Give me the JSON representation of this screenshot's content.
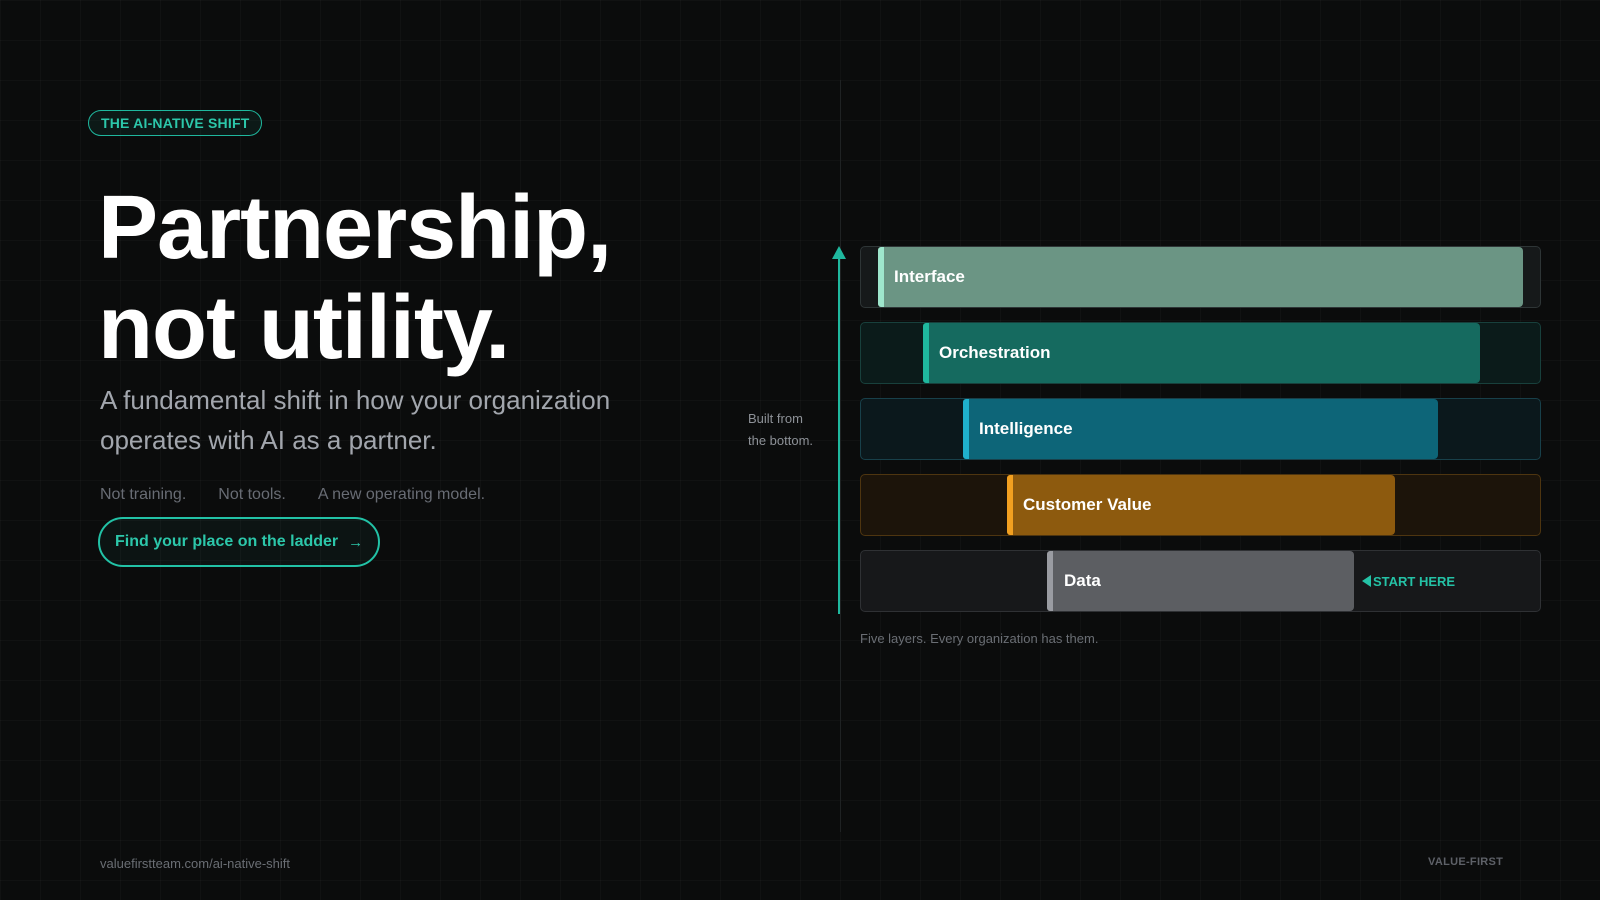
{
  "header": {
    "pill_label": "THE AI-NATIVE SHIFT"
  },
  "hero": {
    "headline_line1": "Partnership,",
    "headline_line2": "not utility.",
    "subtitle": "A fundamental shift in how your organization operates with AI as a partner.",
    "taglines": [
      "Not training.",
      "Not tools.",
      "A new operating model."
    ],
    "cta_label": "Find your place on the ladder",
    "cta_icon": "arrow-right-icon",
    "cta_arrow": "→"
  },
  "ladder": {
    "axis_label_line1": "Built from",
    "axis_label_line2": "the bottom.",
    "layers": [
      {
        "label": "Interface",
        "color": "#6b9584",
        "accent": "#9ee6cc"
      },
      {
        "label": "Orchestration",
        "color": "#156a5f",
        "accent": "#1fb89e"
      },
      {
        "label": "Intelligence",
        "color": "#0d6578",
        "accent": "#1fb0cc"
      },
      {
        "label": "Customer Value",
        "color": "#8d5a0e",
        "accent": "#f2a020"
      },
      {
        "label": "Data",
        "color": "#5c5e62",
        "accent": "#9a9ca2"
      }
    ],
    "start_marker": "START HERE",
    "start_icon": "triangle-left-icon",
    "caption": "Five layers. Every organization has them."
  },
  "footer": {
    "url": "valuefirstteam.com/ai-native-shift",
    "brand": "VALUE-FIRST"
  },
  "colors": {
    "accent": "#1fb89e",
    "background": "#0b0c0c"
  }
}
